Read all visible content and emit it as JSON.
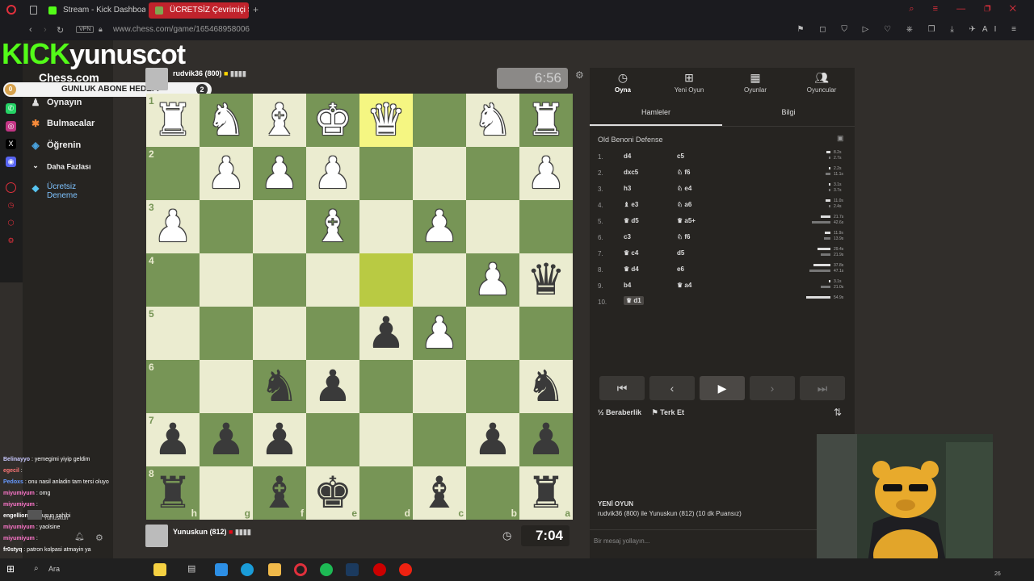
{
  "browser": {
    "tabs": [
      {
        "label": "Stream - Kick Dashboard",
        "color": "#53fc18"
      },
      {
        "label": "ÜCRETSİZ Çevrimiçi Satra",
        "color": "#7fa650"
      }
    ],
    "url": "www.chess.com/game/165468958006",
    "vpn_label": "VPN",
    "right_ai_label": "AI"
  },
  "overlay": {
    "kick_logo": "KICK",
    "streamer": "yunuscot",
    "goal_label": "GUNLUK ABONE HEDEFI",
    "goal_start": "0",
    "goal_target": "2"
  },
  "nav": {
    "logo": "Chess.com",
    "items": [
      {
        "label": "Oynayın",
        "icon": "play-icon"
      },
      {
        "label": "Bulmacalar",
        "icon": "puzzle-icon"
      },
      {
        "label": "Öğrenin",
        "icon": "learn-icon"
      },
      {
        "label": "Daha Fazlası",
        "icon": "chevron-down-icon"
      },
      {
        "label": "Ücretsiz Deneme",
        "icon": "diamond-icon"
      }
    ]
  },
  "top_player": {
    "name": "rudvik36 (800)",
    "clock": "6:56"
  },
  "bottom_player": {
    "name": "Yunuskun (812)",
    "clock": "7:04"
  },
  "board": {
    "files_bottom": [
      "h",
      "g",
      "f",
      "e",
      "d",
      "c",
      "b",
      "a"
    ],
    "ranks_left": [
      "1",
      "2",
      "3",
      "4",
      "5",
      "6",
      "7",
      "8"
    ],
    "pieces": [
      {
        "sq": "h1",
        "p": "♜",
        "c": "w"
      },
      {
        "sq": "g1",
        "p": "♞",
        "c": "w"
      },
      {
        "sq": "f1",
        "p": "♝",
        "c": "w"
      },
      {
        "sq": "e1",
        "p": "♚",
        "c": "w"
      },
      {
        "sq": "d1",
        "p": "♛",
        "c": "w"
      },
      {
        "sq": "b1",
        "p": "♞",
        "c": "w"
      },
      {
        "sq": "a1",
        "p": "♜",
        "c": "w"
      },
      {
        "sq": "g2",
        "p": "♟",
        "c": "w"
      },
      {
        "sq": "f2",
        "p": "♟",
        "c": "w"
      },
      {
        "sq": "e2",
        "p": "♟",
        "c": "w"
      },
      {
        "sq": "a2",
        "p": "♟",
        "c": "w"
      },
      {
        "sq": "h3",
        "p": "♟",
        "c": "w"
      },
      {
        "sq": "e3",
        "p": "♝",
        "c": "w"
      },
      {
        "sq": "c3",
        "p": "♟",
        "c": "w"
      },
      {
        "sq": "b4",
        "p": "♟",
        "c": "w"
      },
      {
        "sq": "a4",
        "p": "♛",
        "c": "b"
      },
      {
        "sq": "d5",
        "p": "♟",
        "c": "b"
      },
      {
        "sq": "c5",
        "p": "♟",
        "c": "w"
      },
      {
        "sq": "f6",
        "p": "♞",
        "c": "b"
      },
      {
        "sq": "e6",
        "p": "♟",
        "c": "b"
      },
      {
        "sq": "a6",
        "p": "♞",
        "c": "b"
      },
      {
        "sq": "h7",
        "p": "♟",
        "c": "b"
      },
      {
        "sq": "g7",
        "p": "♟",
        "c": "b"
      },
      {
        "sq": "f7",
        "p": "♟",
        "c": "b"
      },
      {
        "sq": "b7",
        "p": "♟",
        "c": "b"
      },
      {
        "sq": "a7",
        "p": "♟",
        "c": "b"
      },
      {
        "sq": "h8",
        "p": "♜",
        "c": "b"
      },
      {
        "sq": "f8",
        "p": "♝",
        "c": "b"
      },
      {
        "sq": "e8",
        "p": "♚",
        "c": "b"
      },
      {
        "sq": "c8",
        "p": "♝",
        "c": "b"
      },
      {
        "sq": "a8",
        "p": "♜",
        "c": "b"
      }
    ],
    "highlight": [
      "d1",
      "d4"
    ]
  },
  "panel": {
    "tabs": [
      {
        "label": "Oyna",
        "icon": "stopwatch-icon"
      },
      {
        "label": "Yeni Oyun",
        "icon": "plus-icon"
      },
      {
        "label": "Oyunlar",
        "icon": "board-icon"
      },
      {
        "label": "Oyuncular",
        "icon": "players-icon"
      }
    ],
    "subtabs": [
      "Hamleler",
      "Bilgi"
    ],
    "opening": "Old Benoni Defense",
    "moves": [
      {
        "n": "1.",
        "w": "d4",
        "b": "c5",
        "tw": "8.2s",
        "tb": "2.7s",
        "fw": 0.16,
        "fb": 0.05
      },
      {
        "n": "2.",
        "w": "dxc5",
        "b": "♘ f6",
        "tw": "2.2s",
        "tb": "11.1s",
        "fw": 0.04,
        "fb": 0.2
      },
      {
        "n": "3.",
        "w": "h3",
        "b": "♘ e4",
        "tw": "3.1s",
        "tb": "3.7s",
        "fw": 0.06,
        "fb": 0.07
      },
      {
        "n": "4.",
        "w": "♝ e3",
        "b": "♘ a6",
        "tw": "11.0s",
        "tb": "2.4s",
        "fw": 0.2,
        "fb": 0.05
      },
      {
        "n": "5.",
        "w": "♛ d5",
        "b": "♛ a5+",
        "tw": "21.7s",
        "tb": "42.6s",
        "fw": 0.4,
        "fb": 0.78
      },
      {
        "n": "6.",
        "w": "c3",
        "b": "♘ f6",
        "tw": "11.9s",
        "tb": "13.9s",
        "fw": 0.22,
        "fb": 0.26
      },
      {
        "n": "7.",
        "w": "♛ c4",
        "b": "d5",
        "tw": "29.4s",
        "tb": "21.9s",
        "fw": 0.54,
        "fb": 0.4
      },
      {
        "n": "8.",
        "w": "♛ d4",
        "b": "e6",
        "tw": "37.8s",
        "tb": "47.1s",
        "fw": 0.7,
        "fb": 0.87
      },
      {
        "n": "9.",
        "w": "b4",
        "b": "♛ a4",
        "tw": "3.1s",
        "tb": "21.0s",
        "fw": 0.06,
        "fb": 0.39
      },
      {
        "n": "10.",
        "w": "♛ d1",
        "b": "",
        "tw": "54.9s",
        "tb": "",
        "fw": 1.0,
        "fb": 0
      }
    ],
    "draw_label": "Beraberlik",
    "resign_label": "Terk Et",
    "newgame_title": "YENİ OYUN",
    "newgame_desc": "rudvik36 (800) ile Yunuskun (812) (10 dk Puansız)",
    "message_placeholder": "Bir mesaj yollayın..."
  },
  "chat": [
    {
      "user": "Belinayyo",
      "msg": " : yemegimi yiyip geldim",
      "color": "#c9c9ff"
    },
    {
      "user": "egecil",
      "msg": " : ",
      "color": "#ff7777"
    },
    {
      "user": "Pedoxs",
      "msg": " : onu nasil anladin tam tersi oluyo",
      "color": "#6699ff"
    },
    {
      "user": "miyumiyum",
      "msg": " : omg",
      "color": "#ff77cc"
    },
    {
      "user": "miyumiyum",
      "msg": " : ",
      "color": "#ff77cc"
    },
    {
      "user": "engellion",
      "msg": " : yunusun sahibi",
      "color": "#ffffff"
    },
    {
      "user": "miyumiyum",
      "msg": " : yaolsine",
      "color": "#ff77cc"
    },
    {
      "user": "miyumiyum",
      "msg": " : ",
      "color": "#ff77cc"
    },
    {
      "user": "fr0styq",
      "msg": " : patron kolpasi atmayin ya",
      "color": "#ffffff"
    }
  ],
  "taskbar": {
    "search_label": "Ara",
    "clock_suffix": "26"
  },
  "colors": {
    "kick_green": "#53fc18",
    "board_light": "#ebecd0",
    "board_dark": "#779556"
  }
}
